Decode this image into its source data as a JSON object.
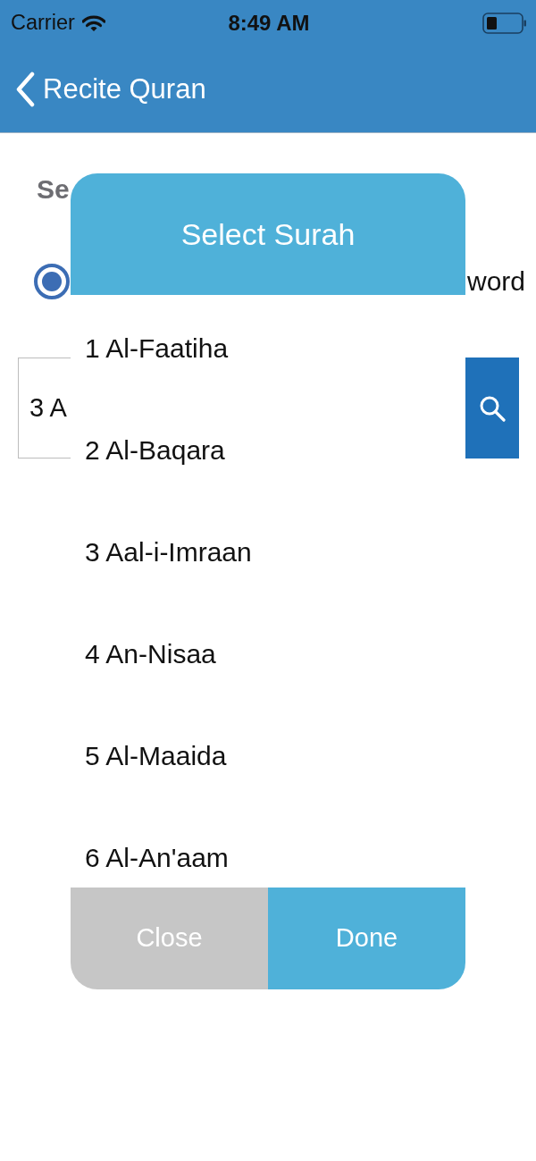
{
  "status_bar": {
    "carrier": "Carrier",
    "time": "8:49 AM"
  },
  "nav_bar": {
    "back_label": "Recite Quran"
  },
  "page": {
    "section_label": "Se",
    "radio_button": {
      "selected": true
    },
    "option_label": "word",
    "search_field": {
      "value": "3 A"
    }
  },
  "dialog": {
    "title": "Select Surah",
    "items": [
      "1 Al-Faatiha",
      "2 Al-Baqara",
      "3 Aal-i-Imraan",
      "4 An-Nisaa",
      "5 Al-Maaida",
      "6 Al-An'aam"
    ],
    "buttons": [
      {
        "label": "Close",
        "kind": "cancel"
      },
      {
        "label": "Done",
        "kind": "confirm"
      }
    ]
  }
}
